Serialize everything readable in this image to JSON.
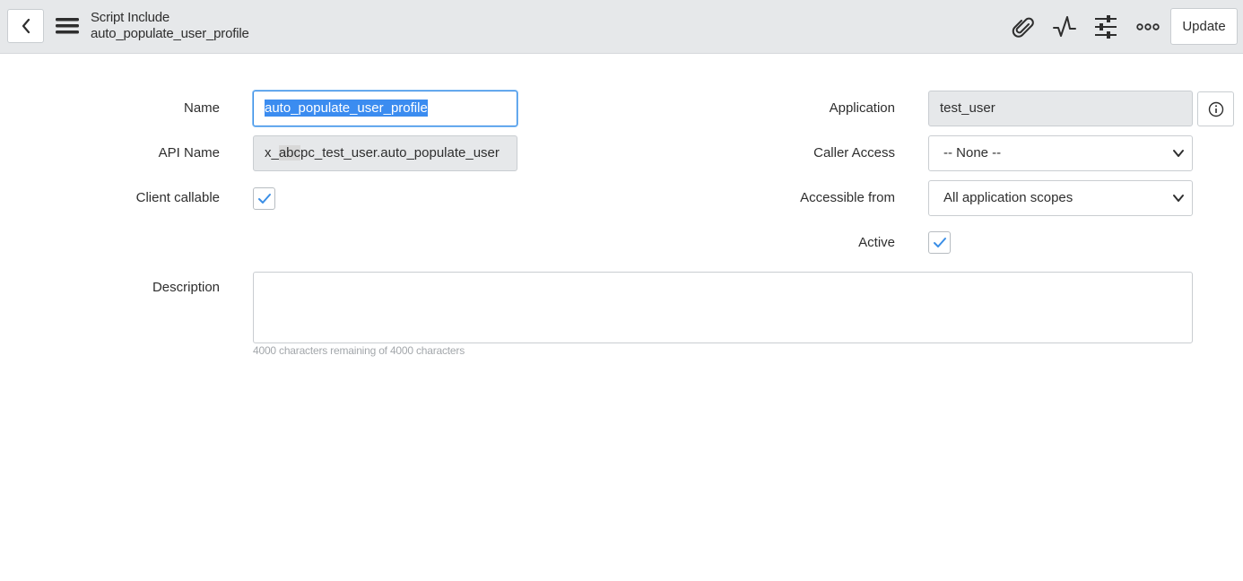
{
  "header": {
    "record_type": "Script Include",
    "record_name": "auto_populate_user_profile",
    "update_label": "Update",
    "icons": [
      "chevron-left-icon",
      "hamburger-menu-icon",
      "paperclip-icon",
      "activity-pulse-icon",
      "sliders-icon",
      "more-options-icon"
    ]
  },
  "form": {
    "name": {
      "label": "Name",
      "value": "auto_populate_user_profile"
    },
    "api_name": {
      "label": "API Name",
      "value_prefix": "x_",
      "value_highlight": "abc",
      "value_suffix": "pc_test_user.auto_populate_user"
    },
    "client_callable": {
      "label": "Client callable",
      "checked": true
    },
    "application": {
      "label": "Application",
      "value": "test_user"
    },
    "caller_access": {
      "label": "Caller Access",
      "value": "-- None --"
    },
    "accessible_from": {
      "label": "Accessible from",
      "value": "All application scopes"
    },
    "active": {
      "label": "Active",
      "checked": true
    },
    "description": {
      "label": "Description",
      "value": "",
      "hint": "4000 characters remaining of 4000 characters"
    }
  },
  "colors": {
    "header_bg": "#e6e8ea",
    "accent": "#3a8ee6",
    "readonly_bg": "#e6e8ea"
  }
}
